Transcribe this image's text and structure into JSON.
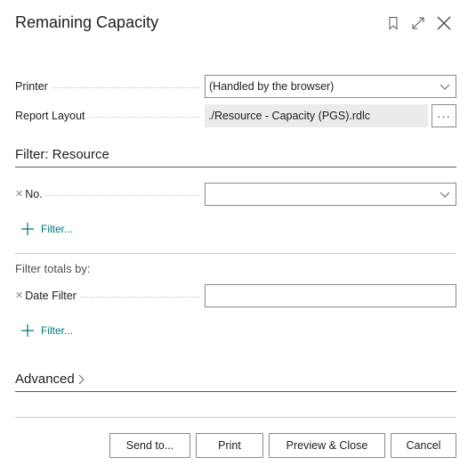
{
  "dialog": {
    "title": "Remaining Capacity",
    "header_icons": [
      "bookmark-icon",
      "expand-icon",
      "close-icon"
    ]
  },
  "options": {
    "printer": {
      "label": "Printer",
      "value": "(Handled by the browser)"
    },
    "report_layout": {
      "label": "Report Layout",
      "value": "./Resource - Capacity (PGS).rdlc",
      "button_label": "···"
    }
  },
  "filter_resource": {
    "title": "Filter: Resource",
    "fields": [
      {
        "label": "No.",
        "value": ""
      }
    ],
    "add_filter_label": "Filter..."
  },
  "filter_totals": {
    "title": "Filter totals by:",
    "fields": [
      {
        "label": "Date Filter",
        "value": ""
      }
    ],
    "add_filter_label": "Filter..."
  },
  "advanced": {
    "label": "Advanced"
  },
  "buttons": {
    "send_to": "Send to...",
    "print": "Print",
    "preview_close": "Preview & Close",
    "cancel": "Cancel"
  },
  "colors": {
    "accent": "#00747a",
    "section_line": "#505c6d",
    "readonly_bg": "#ebebeb",
    "border": "#8a8a8a"
  }
}
